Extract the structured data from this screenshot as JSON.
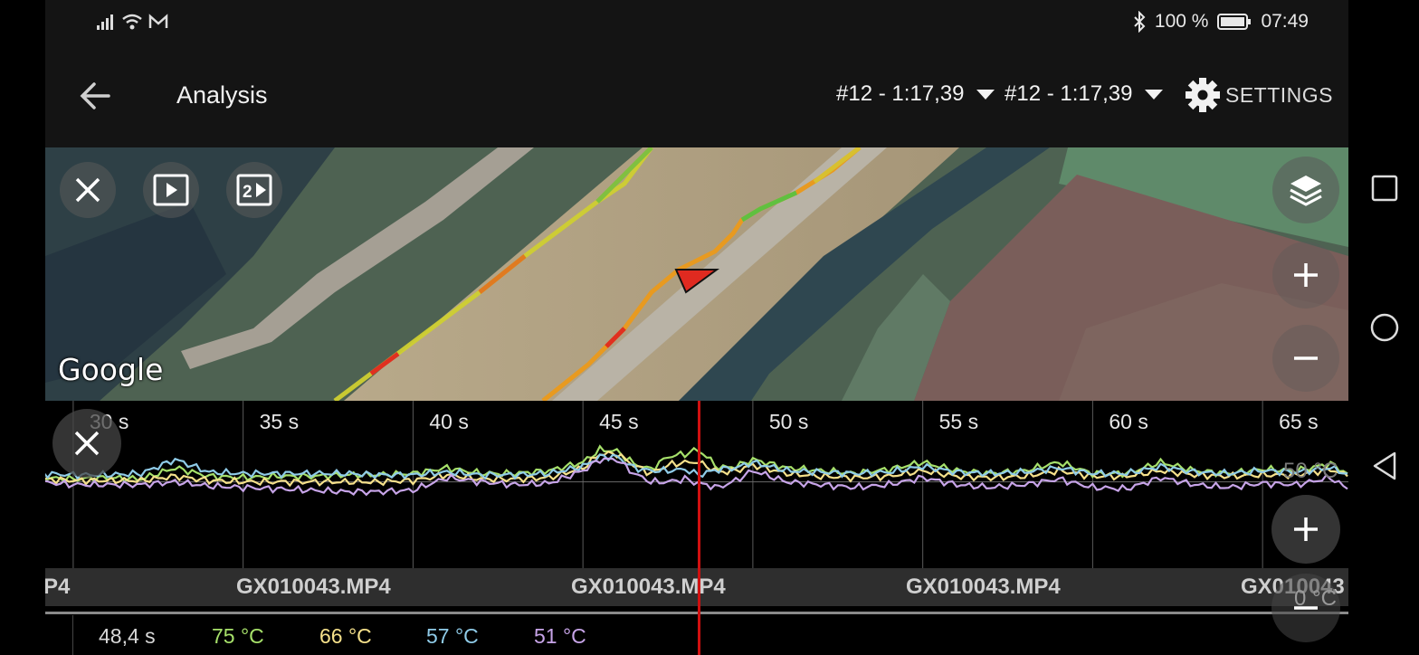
{
  "status_bar": {
    "battery": "100 %",
    "time": "07:49"
  },
  "app_bar": {
    "title": "Analysis",
    "lap_a": "#12 - 1:17,39",
    "lap_b": "#12 - 1:17,39",
    "settings_label": "SETTINGS"
  },
  "map": {
    "attribution": "Google",
    "icons": [
      "close-icon",
      "play-video-icon",
      "dual-video-icon",
      "layers-icon",
      "zoom-in-icon",
      "zoom-out-icon"
    ]
  },
  "chart": {
    "ticks": [
      "30 s",
      "35 s",
      "40 s",
      "45 s",
      "50 s",
      "55 s",
      "60 s",
      "65 s"
    ],
    "series_colors": [
      "#a6e06a",
      "#f5e08a",
      "#8fcbe8",
      "#c7a4e8"
    ],
    "cursor_color": "#d01010",
    "faded_label": "50 °C",
    "scale_label": "0 °C"
  },
  "chart_data": {
    "type": "line",
    "title": "",
    "xlabel": "",
    "ylabel": "",
    "x_ticks": [
      "30 s",
      "35 s",
      "40 s",
      "45 s",
      "50 s",
      "55 s",
      "60 s",
      "65 s"
    ],
    "xlim": [
      29,
      67.5
    ],
    "ylim": [
      0,
      110
    ],
    "cursor_x": 48.4,
    "series": [
      {
        "color": "#a6e06a",
        "x": [
          29,
          30,
          31,
          32,
          33,
          34,
          35,
          36,
          37,
          38,
          39,
          40,
          41,
          42,
          43,
          44,
          45,
          45.5,
          46,
          46.5,
          47,
          47.5,
          48,
          48.4,
          49,
          49.5,
          50,
          51,
          52,
          53,
          54,
          55,
          56,
          57,
          58,
          59,
          60,
          61,
          62,
          63,
          64,
          65,
          66,
          67,
          67.5
        ],
        "values": [
          55,
          54,
          55,
          54,
          62,
          56,
          55,
          56,
          56,
          57,
          57,
          58,
          62,
          58,
          58,
          60,
          66,
          75,
          74,
          65,
          61,
          70,
          72,
          75,
          62,
          63,
          68,
          62,
          60,
          58,
          61,
          66,
          60,
          58,
          60,
          66,
          58,
          58,
          66,
          60,
          58,
          61,
          60,
          65,
          58
        ]
      },
      {
        "color": "#f5e08a",
        "x": [
          29,
          30,
          31,
          32,
          33,
          34,
          35,
          36,
          37,
          38,
          39,
          40,
          41,
          42,
          43,
          44,
          45,
          45.5,
          46,
          46.5,
          47,
          47.5,
          48,
          48.4,
          49,
          49.5,
          50,
          51,
          52,
          53,
          54,
          55,
          56,
          57,
          58,
          59,
          60,
          61,
          62,
          63,
          64,
          65,
          66,
          67,
          67.5
        ],
        "values": [
          54,
          53,
          53,
          53,
          56,
          53,
          52,
          52,
          52,
          52,
          52,
          53,
          57,
          54,
          54,
          55,
          62,
          72,
          72,
          64,
          58,
          64,
          66,
          66,
          59,
          60,
          64,
          58,
          56,
          55,
          56,
          60,
          56,
          55,
          56,
          60,
          56,
          56,
          60,
          57,
          56,
          57,
          57,
          61,
          56
        ]
      },
      {
        "color": "#8fcbe8",
        "x": [
          29,
          30,
          31,
          32,
          33,
          34,
          35,
          36,
          37,
          38,
          39,
          40,
          41,
          42,
          43,
          44,
          45,
          45.5,
          46,
          46.5,
          47,
          47.5,
          48,
          48.4,
          49,
          49.5,
          50,
          51,
          52,
          53,
          54,
          55,
          56,
          57,
          58,
          59,
          60,
          61,
          62,
          63,
          64,
          65,
          66,
          67,
          67.5
        ],
        "values": [
          58,
          57,
          57,
          58,
          68,
          59,
          58,
          58,
          58,
          58,
          57,
          57,
          59,
          57,
          57,
          58,
          63,
          70,
          70,
          62,
          60,
          60,
          61,
          57,
          61,
          62,
          66,
          60,
          59,
          58,
          59,
          63,
          59,
          58,
          59,
          62,
          58,
          58,
          63,
          59,
          58,
          60,
          59,
          62,
          58
        ]
      },
      {
        "color": "#c7a4e8",
        "x": [
          29,
          30,
          31,
          32,
          33,
          34,
          35,
          36,
          37,
          38,
          39,
          40,
          41,
          42,
          43,
          44,
          45,
          45.5,
          46,
          46.5,
          47,
          47.5,
          48,
          48.4,
          49,
          49.5,
          50,
          51,
          52,
          53,
          54,
          55,
          56,
          57,
          58,
          59,
          60,
          61,
          62,
          63,
          64,
          65,
          66,
          67,
          67.5
        ],
        "values": [
          52,
          50,
          50,
          50,
          52,
          49,
          48,
          47,
          46,
          45,
          45,
          46,
          55,
          52,
          50,
          51,
          60,
          68,
          68,
          58,
          52,
          52,
          54,
          51,
          48,
          53,
          60,
          52,
          50,
          48,
          50,
          55,
          50,
          48,
          50,
          54,
          48,
          47,
          55,
          50,
          48,
          51,
          50,
          55,
          47
        ]
      }
    ]
  },
  "files": [
    "P4",
    "GX010043.MP4",
    "GX010043.MP4",
    "GX010043.MP4",
    "GX010043"
  ],
  "readouts": [
    {
      "label": "48,4 s",
      "color": "#d8d8d8"
    },
    {
      "label": "75 °C",
      "color": "#a6e06a"
    },
    {
      "label": "66 °C",
      "color": "#f5e08a"
    },
    {
      "label": "57 °C",
      "color": "#8fcbe8"
    },
    {
      "label": "51 °C",
      "color": "#c7a4e8"
    }
  ]
}
